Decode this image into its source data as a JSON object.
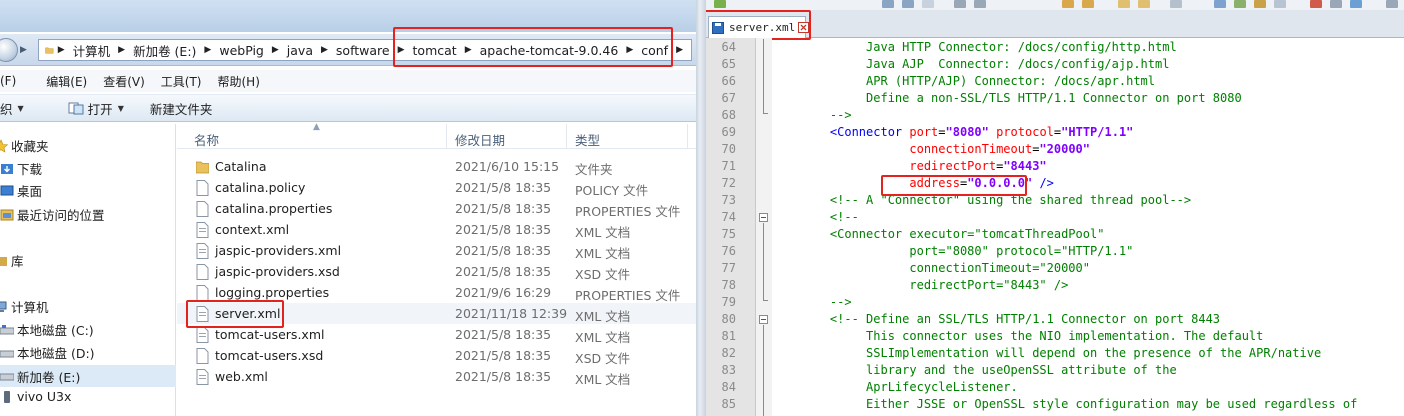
{
  "explorer": {
    "title_ghost": "...",
    "address_crumbs": [
      "计算机",
      "新加卷 (E:)",
      "webPig",
      "java",
      "software",
      "tomcat",
      "apache-tomcat-9.0.46",
      "conf"
    ],
    "menu": [
      "(F)",
      "编辑(E)",
      "查看(V)",
      "工具(T)",
      "帮助(H)"
    ],
    "toolbar": {
      "organize": "织",
      "open": "打开",
      "new_folder": "新建文件夹"
    },
    "nav": {
      "favorites": "收藏夹",
      "downloads": "下载",
      "desktop": "桌面",
      "recent": "最近访问的位置",
      "libraries": "库",
      "computer": "计算机",
      "drive_c": "本地磁盘 (C:)",
      "drive_d": "本地磁盘 (D:)",
      "drive_e": "新加卷 (E:)",
      "device": "vivo U3x"
    },
    "columns": {
      "name": "名称",
      "date": "修改日期",
      "type": "类型"
    },
    "files": [
      {
        "name": "Catalina",
        "date": "2021/6/10 15:15",
        "type": "文件夹",
        "kind": "folder"
      },
      {
        "name": "catalina.policy",
        "date": "2021/5/8 18:35",
        "type": "POLICY 文件",
        "kind": "file"
      },
      {
        "name": "catalina.properties",
        "date": "2021/5/8 18:35",
        "type": "PROPERTIES 文件",
        "kind": "file"
      },
      {
        "name": "context.xml",
        "date": "2021/5/8 18:35",
        "type": "XML 文档",
        "kind": "xml"
      },
      {
        "name": "jaspic-providers.xml",
        "date": "2021/5/8 18:35",
        "type": "XML 文档",
        "kind": "xml"
      },
      {
        "name": "jaspic-providers.xsd",
        "date": "2021/5/8 18:35",
        "type": "XSD 文件",
        "kind": "file"
      },
      {
        "name": "logging.properties",
        "date": "2021/9/6 16:29",
        "type": "PROPERTIES 文件",
        "kind": "file"
      },
      {
        "name": "server.xml",
        "date": "2021/11/18 12:39",
        "type": "XML 文档",
        "kind": "xml"
      },
      {
        "name": "tomcat-users.xml",
        "date": "2021/5/8 18:35",
        "type": "XML 文档",
        "kind": "xml"
      },
      {
        "name": "tomcat-users.xsd",
        "date": "2021/5/8 18:35",
        "type": "XSD 文件",
        "kind": "file"
      },
      {
        "name": "web.xml",
        "date": "2021/5/8 18:35",
        "type": "XML 文档",
        "kind": "xml"
      }
    ]
  },
  "editor": {
    "tab_label": "server.xml",
    "line_numbers": [
      "64",
      "65",
      "66",
      "67",
      "68",
      "69",
      "70",
      "71",
      "72",
      "73",
      "74",
      "75",
      "76",
      "77",
      "78",
      "79",
      "80",
      "81",
      "82",
      "83",
      "84",
      "85"
    ],
    "code": {
      "l64": "         Java HTTP Connector: /docs/config/http.html",
      "l65": "         Java AJP  Connector: /docs/config/ajp.html",
      "l66": "         APR (HTTP/AJP) Connector: /docs/apr.html",
      "l67": "         Define a non-SSL/TLS HTTP/1.1 Connector on port 8080",
      "l68": "    -->",
      "l69_tag": "    <Connector",
      "l69_a1": " port",
      "l69_v1": "\"8080\"",
      "l69_a2": " protocol",
      "l69_v2": "\"HTTP/1.1\"",
      "l70_a": "               connectionTimeout",
      "l70_v": "\"20000\"",
      "l71_a": "               redirectPort",
      "l71_v": "\"8443\"",
      "l72_a": "               address",
      "l72_v": "\"0.0.0.0\"",
      "l72_end": " />",
      "l73": "    <!-- A \"Connector\" using the shared thread pool-->",
      "l74": "    <!--",
      "l75": "    <Connector executor=\"tomcatThreadPool\"",
      "l76": "               port=\"8080\" protocol=\"HTTP/1.1\"",
      "l77": "               connectionTimeout=\"20000\"",
      "l78": "               redirectPort=\"8443\" />",
      "l79": "    -->",
      "l80": "    <!-- Define an SSL/TLS HTTP/1.1 Connector on port 8443",
      "l81": "         This connector uses the NIO implementation. The default",
      "l82": "         SSLImplementation will depend on the presence of the APR/native",
      "l83": "         library and the useOpenSSL attribute of the",
      "l84": "         AprLifecycleListener.",
      "l85": "         Either JSSE or OpenSSL style configuration may be used regardless of"
    }
  },
  "colors": {
    "highlight": "#e4231f",
    "xml_tag": "#0000ff",
    "xml_attr": "#ff0000",
    "xml_value": "#8000ff",
    "comment": "#008000"
  }
}
